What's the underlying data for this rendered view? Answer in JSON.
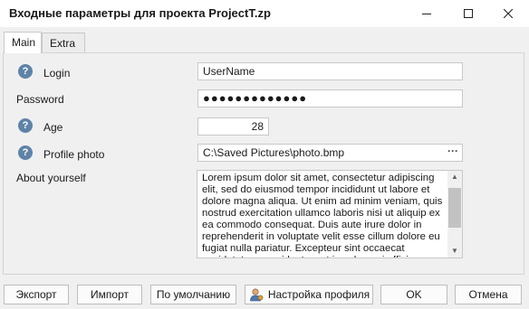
{
  "window": {
    "title": "Входные параметры для проекта ProjectT.zp"
  },
  "tabs": [
    {
      "label": "Main",
      "active": true
    },
    {
      "label": "Extra",
      "active": false
    }
  ],
  "help_glyph": "?",
  "form": {
    "login": {
      "label": "Login",
      "value": "UserName"
    },
    "password": {
      "label": "Password",
      "value": "●●●●●●●●●●●●●"
    },
    "age": {
      "label": "Age",
      "value": "28"
    },
    "photo": {
      "label": "Profile photo",
      "value": "C:\\Saved Pictures\\photo.bmp",
      "browse": "···"
    },
    "about": {
      "label": "About yourself",
      "value": "Lorem ipsum dolor sit amet, consectetur adipiscing elit, sed do eiusmod tempor incididunt ut labore et dolore magna aliqua. Ut enim ad minim veniam, quis nostrud exercitation ullamco laboris nisi ut aliquip ex ea commodo consequat. Duis aute irure dolor in reprehenderit in voluptate velit esse cillum dolore eu fugiat nulla pariatur. Excepteur sint occaecat cupidatat non proident, sunt in culpa qui officia deserunt mollit"
    }
  },
  "buttons": {
    "export": "Экспорт",
    "import": "Импорт",
    "default": "По умолчанию",
    "profile": "Настройка профиля",
    "ok": "OK",
    "cancel": "Отмена"
  },
  "icons": {
    "help": "help-circle-icon",
    "minimize": "minimize-icon",
    "maximize": "maximize-icon",
    "close": "close-icon",
    "profile": "user-settings-icon"
  }
}
